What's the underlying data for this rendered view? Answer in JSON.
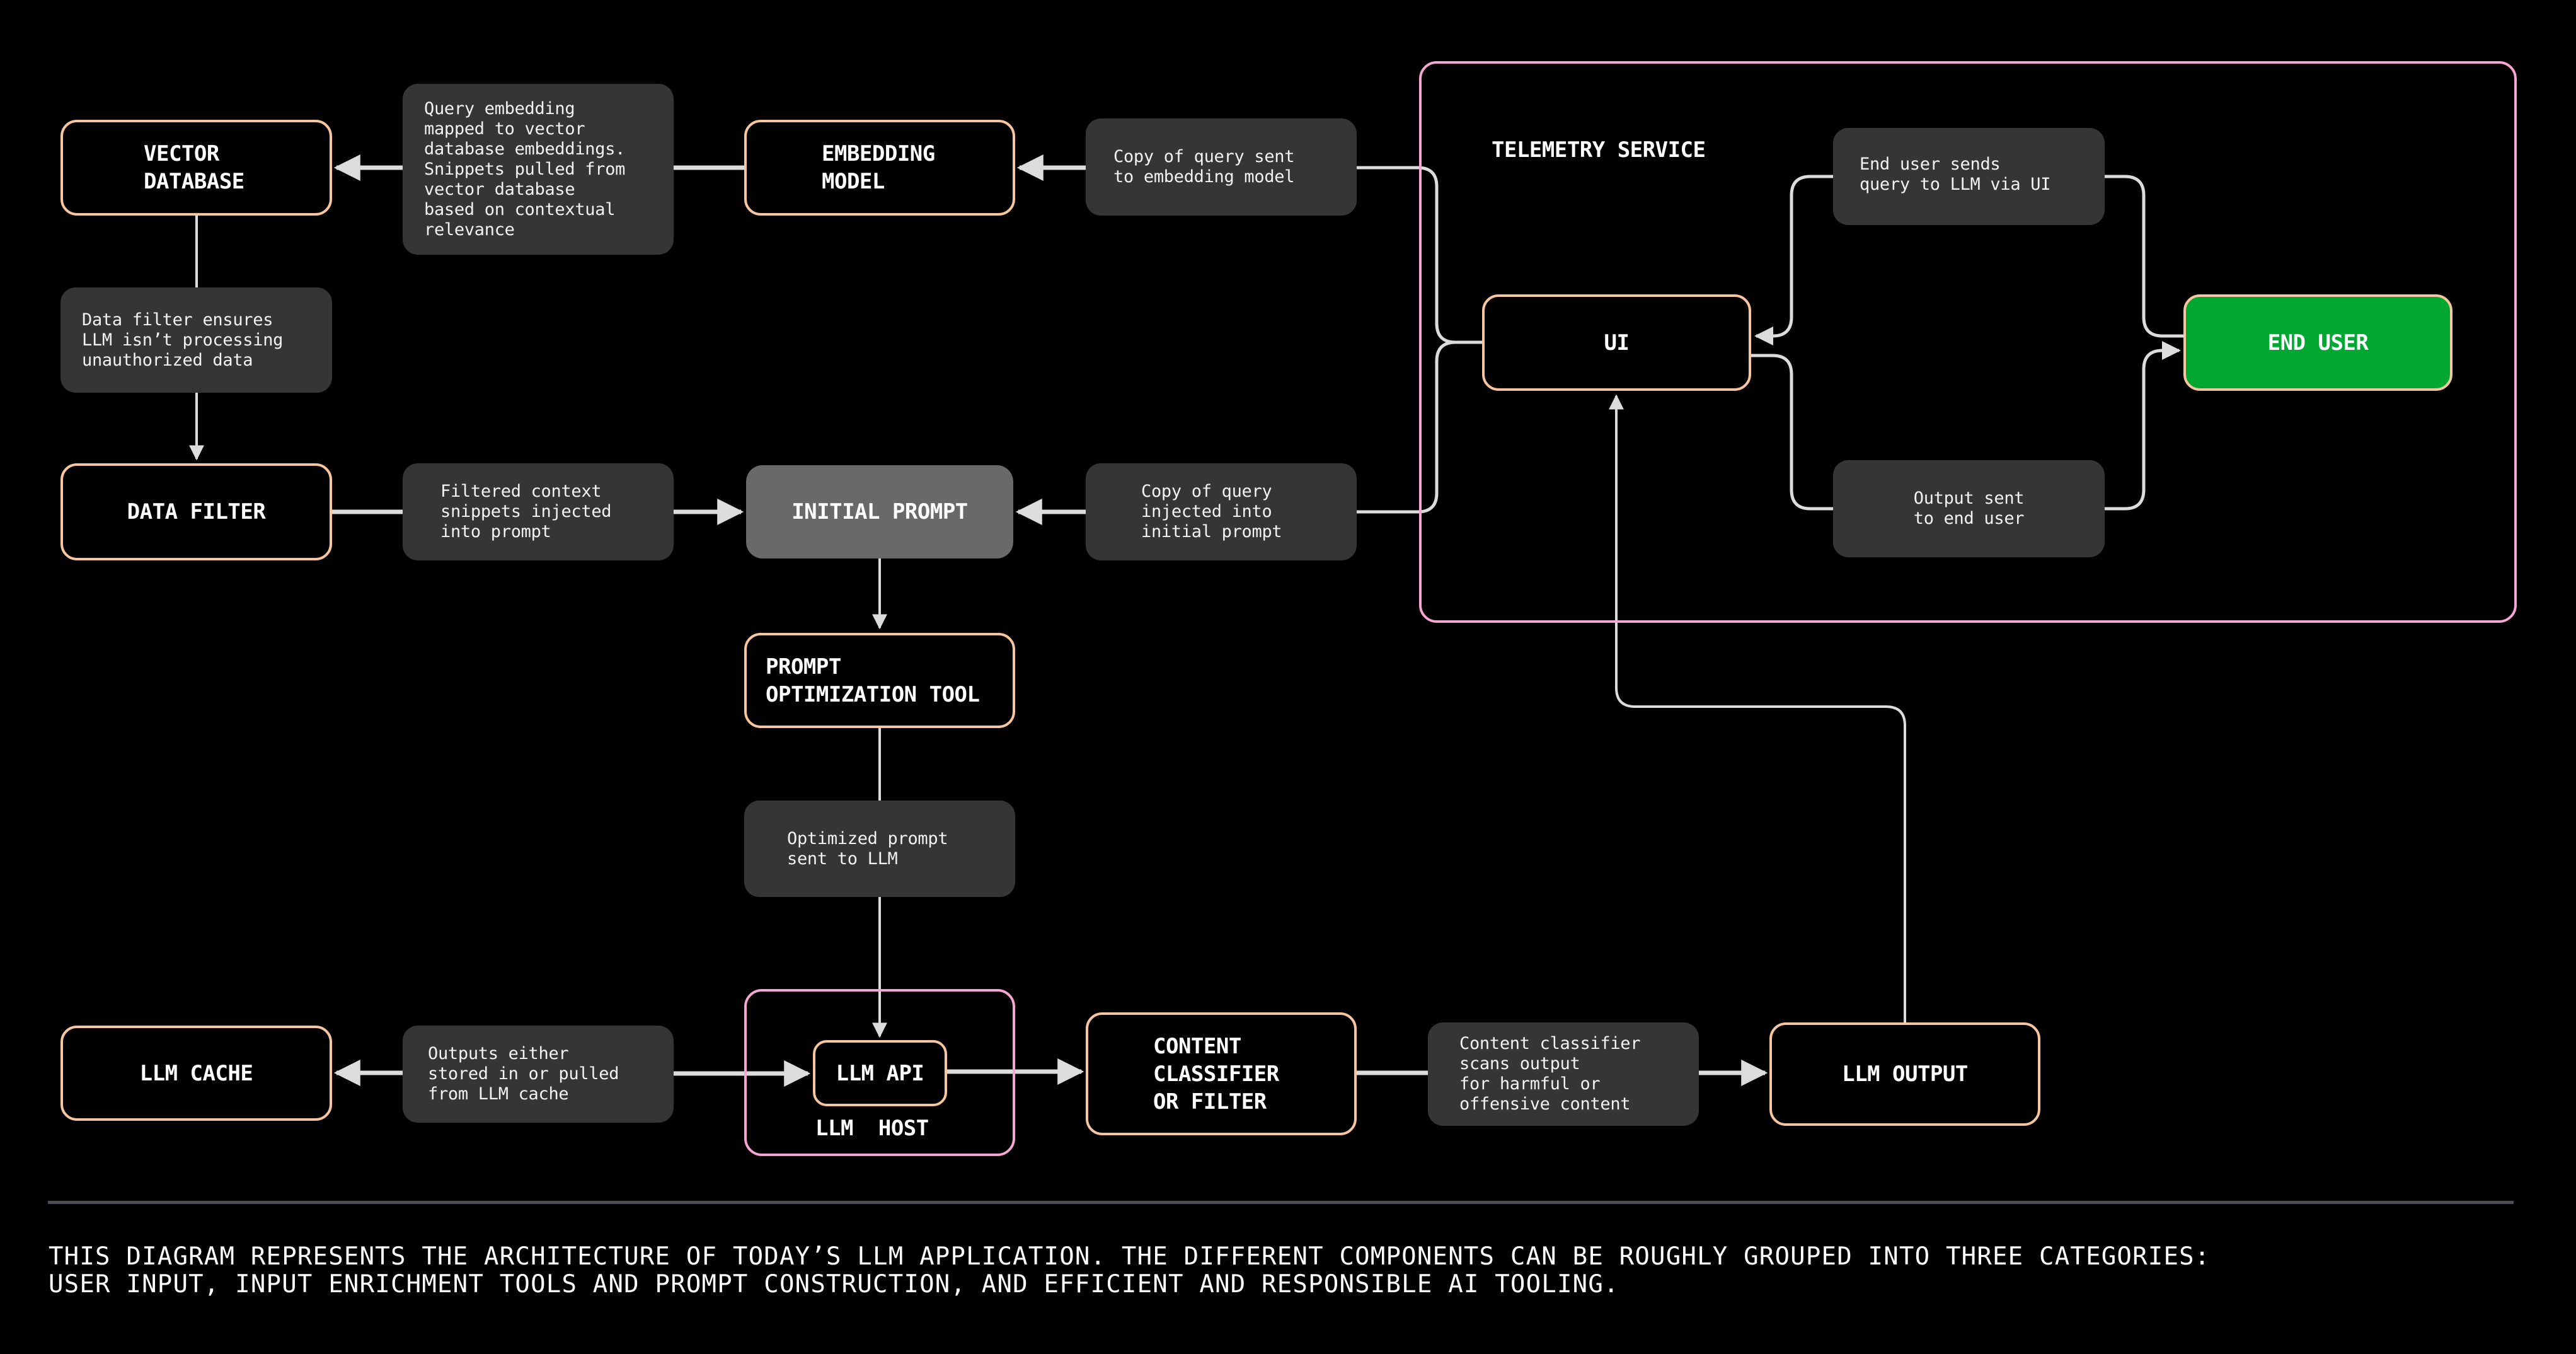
{
  "colors": {
    "background": "#000000",
    "node_border": "#F7C5A0",
    "group_border": "#F6A6D2",
    "note_fill": "#353535",
    "initial_prompt_fill": "#696969",
    "end_user_fill": "#00A832",
    "connector": "#DCDCDC",
    "divider": "#4A4D55"
  },
  "nodes": {
    "vector_database": "VECTOR\nDATABASE",
    "embedding_model": "EMBEDDING\nMODEL",
    "data_filter": "DATA FILTER",
    "initial_prompt": "INITIAL PROMPT",
    "prompt_optimization_tool": "PROMPT\nOPTIMIZATION TOOL",
    "llm_cache": "LLM CACHE",
    "llm_api": "LLM API",
    "content_classifier": "CONTENT\nCLASSIFIER\nOR FILTER",
    "llm_output": "LLM OUTPUT",
    "ui": "UI",
    "end_user": "END USER"
  },
  "groups": {
    "telemetry_service": "TELEMETRY SERVICE",
    "llm_host": "LLM  HOST"
  },
  "notes": {
    "query_embedding": "Query embedding\nmapped to vector\ndatabase embeddings.\nSnippets pulled from\nvector database\nbased on contextual\nrelevance",
    "copy_to_embedding": "Copy of query sent\nto embedding model",
    "data_filter_ensures": "Data filter ensures\nLLM isn’t processing\nunauthorized data",
    "filtered_context": "Filtered context\nsnippets injected\ninto prompt",
    "copy_to_initial_prompt": "Copy of query\ninjected into\ninitial prompt",
    "optimized_prompt": "Optimized prompt\nsent to LLM",
    "outputs_cache": "Outputs either\nstored in or pulled\nfrom LLM cache",
    "content_classifier_scans": "Content classifier\nscans output\nfor harmful or\noffensive content",
    "end_user_sends": "End user sends\nquery to LLM via UI",
    "output_sent": "Output sent\nto end user"
  },
  "footer": {
    "caption": "THIS DIAGRAM REPRESENTS THE ARCHITECTURE OF TODAY’S LLM APPLICATION. THE DIFFERENT COMPONENTS CAN BE ROUGHLY GROUPED INTO THREE CATEGORIES:\nUSER INPUT, INPUT ENRICHMENT TOOLS AND PROMPT CONSTRUCTION, AND EFFICIENT AND RESPONSIBLE AI TOOLING."
  }
}
